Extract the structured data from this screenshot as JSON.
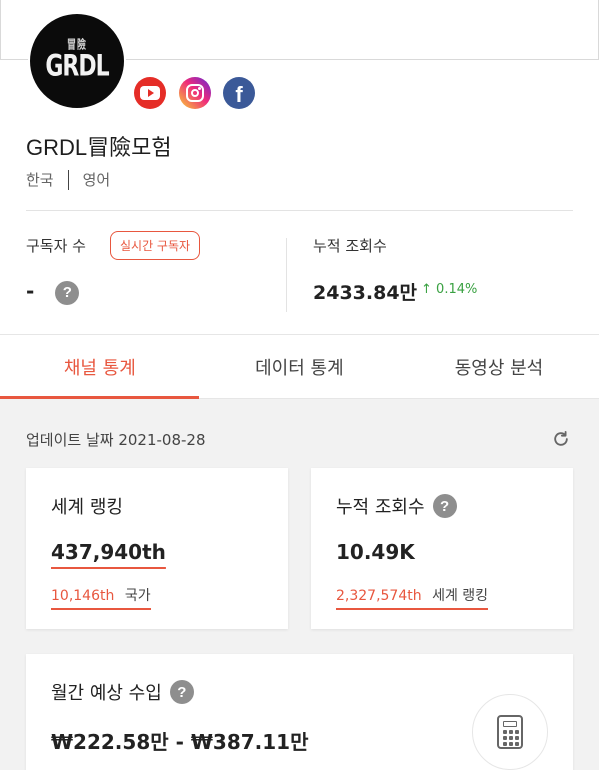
{
  "channel": {
    "avatar_text": "GRDL",
    "avatar_subtext": "冒險",
    "name": "GRDL冒險모험",
    "languages": [
      "한국",
      "영어"
    ],
    "social": [
      "youtube-icon",
      "instagram-icon",
      "facebook-icon"
    ]
  },
  "stats": {
    "subscribers_label": "구독자 수",
    "realtime_badge": "실시간 구독자",
    "subscribers_value": "-",
    "views_label": "누적 조회수",
    "views_value": "2433.84만",
    "views_change": "0.14%",
    "views_change_dir": "up",
    "help_icon": "?"
  },
  "tabs": [
    {
      "label": "채널 통계",
      "active": true
    },
    {
      "label": "데이터 통계",
      "active": false
    },
    {
      "label": "동영상 분석",
      "active": false
    }
  ],
  "content": {
    "update_text": "업데이트 날짜 2021-08-28",
    "cards": {
      "world_rank": {
        "title": "세계 랭킹",
        "value": "437,940th",
        "sub_value": "10,146th",
        "sub_label": "국가"
      },
      "total_views": {
        "title": "누적 조회수",
        "value": "10.49K",
        "sub_value": "2,327,574th",
        "sub_label": "세계 랭킹"
      },
      "monthly_income": {
        "title": "월간 예상 수입",
        "value": "₩222.58만 - ₩387.11만"
      }
    }
  },
  "colors": {
    "accent": "#e8573f",
    "positive": "#3aa142",
    "youtube": "#e52d27",
    "facebook": "#3b5998",
    "background_grey": "#f2f2f2"
  }
}
